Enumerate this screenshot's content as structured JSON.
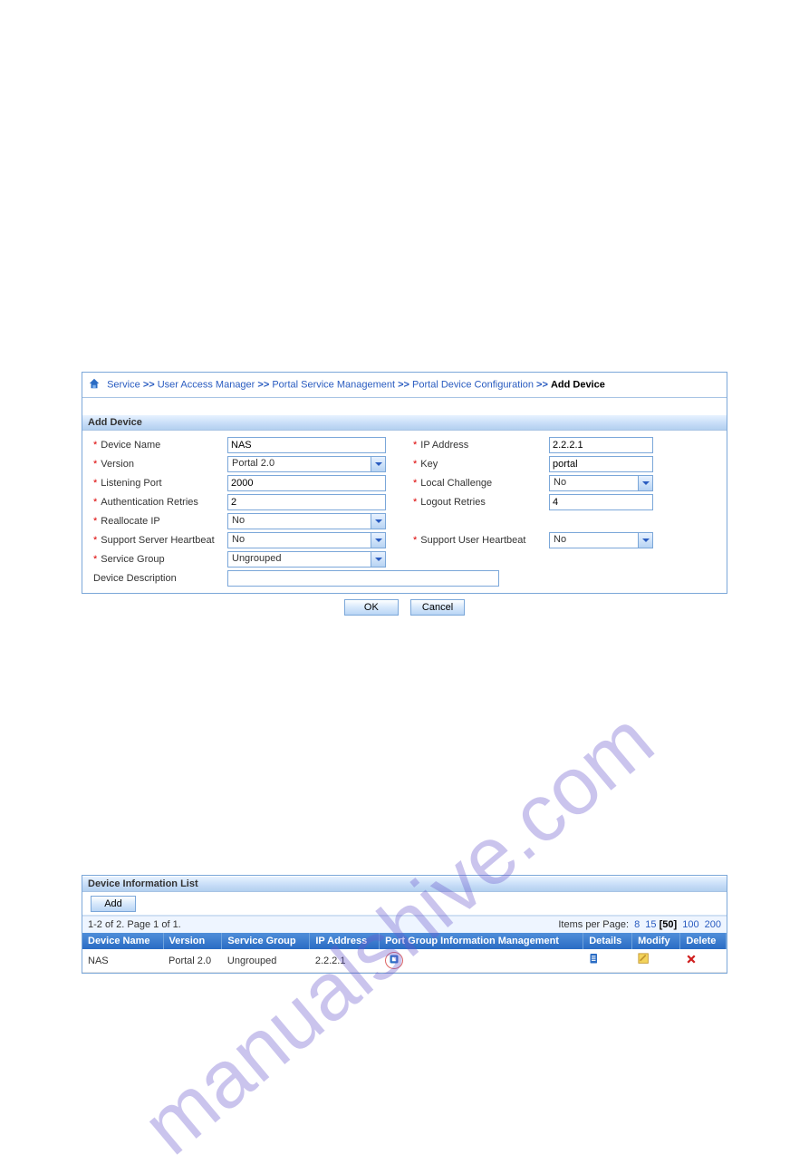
{
  "watermark": "manualshive.com",
  "breadcrumb": {
    "service": "Service",
    "uam": "User Access Manager",
    "psm": "Portal Service Management",
    "pdc": "Portal Device Configuration",
    "add": "Add Device"
  },
  "form": {
    "title": "Add Device",
    "labels": {
      "deviceName": "Device Name",
      "ipAddress": "IP Address",
      "version": "Version",
      "key": "Key",
      "listeningPort": "Listening Port",
      "localChallenge": "Local Challenge",
      "authRetries": "Authentication Retries",
      "logoutRetries": "Logout Retries",
      "reallocateIp": "Reallocate IP",
      "supportServerHb": "Support Server Heartbeat",
      "supportUserHb": "Support User Heartbeat",
      "serviceGroup": "Service Group",
      "deviceDescription": "Device Description"
    },
    "values": {
      "deviceName": "NAS",
      "ipAddress": "2.2.2.1",
      "version": "Portal 2.0",
      "key": "portal",
      "listeningPort": "2000",
      "localChallenge": "No",
      "authRetries": "2",
      "logoutRetries": "4",
      "reallocateIp": "No",
      "supportServerHb": "No",
      "supportUserHb": "No",
      "serviceGroup": "Ungrouped",
      "deviceDescription": ""
    },
    "buttons": {
      "ok": "OK",
      "cancel": "Cancel"
    }
  },
  "list": {
    "title": "Device Information List",
    "addBtn": "Add",
    "pager": {
      "range": "1-2 of 2. Page 1 of 1.",
      "ipp": "Items per Page:",
      "opts": [
        "8",
        "15",
        "[50]",
        "100",
        "200"
      ],
      "cur": 2
    },
    "cols": {
      "deviceName": "Device Name",
      "version": "Version",
      "serviceGroup": "Service Group",
      "ipAddress": "IP Address",
      "pgim": "Port Group Information Management",
      "details": "Details",
      "modify": "Modify",
      "delete": "Delete"
    },
    "rows": [
      {
        "deviceName": "NAS",
        "version": "Portal 2.0",
        "serviceGroup": "Ungrouped",
        "ipAddress": "2.2.2.1"
      }
    ]
  }
}
